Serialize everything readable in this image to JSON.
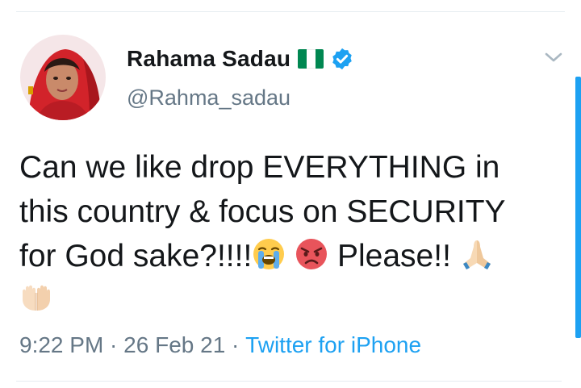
{
  "author": {
    "display_name": "Rahama Sadau",
    "handle": "@Rahma_sadau",
    "flag": "nigeria-flag",
    "verified": true
  },
  "tweet": {
    "line1": "Can we like drop EVERYTHING in",
    "line2": "this country & focus on SECURITY",
    "line3_prefix": "for God sake?!!!!",
    "line3_suffix": " Please!! ",
    "emojis": [
      "loudly-crying-face",
      "pouting-face",
      "folded-hands",
      "palms-up-together"
    ]
  },
  "meta": {
    "time": "9:22 PM",
    "separator": " · ",
    "date": "26 Feb 21",
    "source": "Twitter for iPhone"
  },
  "colors": {
    "accent": "#1da1f2",
    "text": "#14171a",
    "secondary": "#657786",
    "flag_green": "#008751"
  }
}
